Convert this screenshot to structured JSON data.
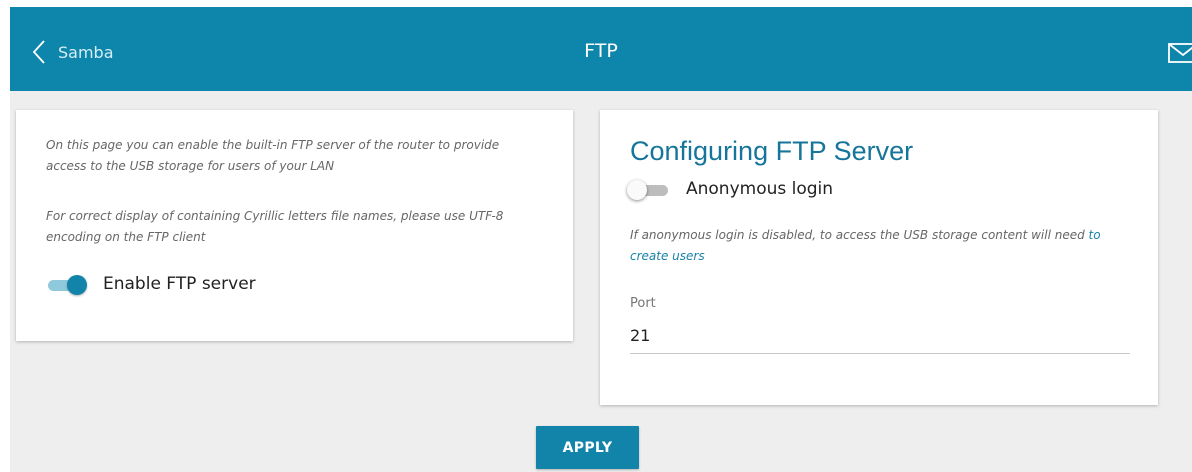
{
  "header": {
    "back_label": "Samba",
    "title": "FTP",
    "back_icon": "chevron-left-icon",
    "mail_icon": "envelope-icon",
    "color": "#0e86ab"
  },
  "info_card": {
    "description_1": "On this page you can enable the built-in FTP server of the router to provide access to the USB storage for users of your LAN",
    "description_2": "For correct display of containing Cyrillic letters file names, please use UTF-8 encoding on the FTP client",
    "enable_ftp": {
      "label": "Enable FTP server",
      "state": "on"
    }
  },
  "config_card": {
    "title": "Configuring FTP Server",
    "anonymous_login": {
      "label": "Anonymous login",
      "state": "off"
    },
    "note_text": "If anonymous login is disabled, to access the USB storage content will need ",
    "note_link": "to create users",
    "port": {
      "label": "Port",
      "value": "21"
    }
  },
  "actions": {
    "apply_label": "APPLY"
  },
  "colors": {
    "accent": "#1384a9",
    "background": "#eeeeee",
    "title_text": "#16759a"
  }
}
